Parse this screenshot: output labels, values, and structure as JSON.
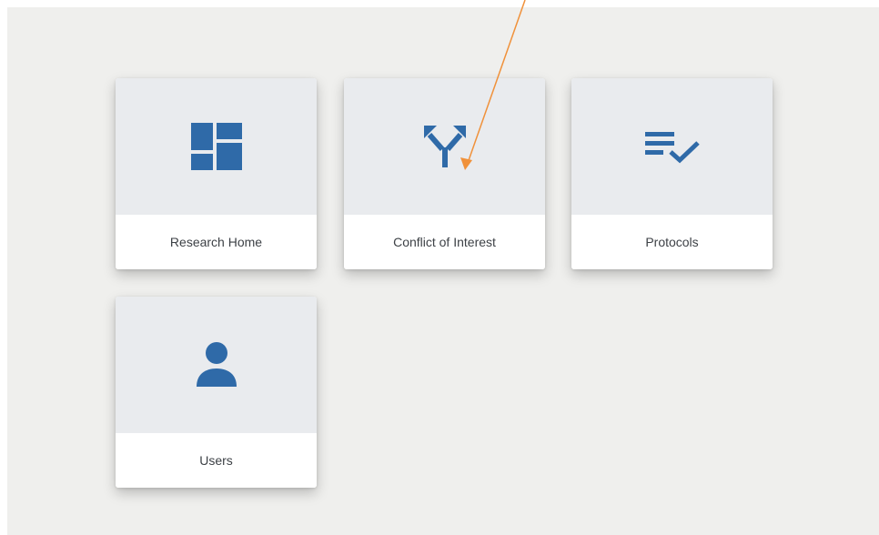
{
  "colors": {
    "icon": "#2f6aa8",
    "panel_background": "#efefed",
    "tile_icon_background": "#e9ebee",
    "annotation_arrow": "#f0913a"
  },
  "tiles": [
    {
      "label": "Research Home",
      "icon": "dashboard-icon"
    },
    {
      "label": "Conflict of Interest",
      "icon": "split-arrows-icon"
    },
    {
      "label": "Protocols",
      "icon": "checklist-icon"
    },
    {
      "label": "Users",
      "icon": "person-icon"
    }
  ]
}
